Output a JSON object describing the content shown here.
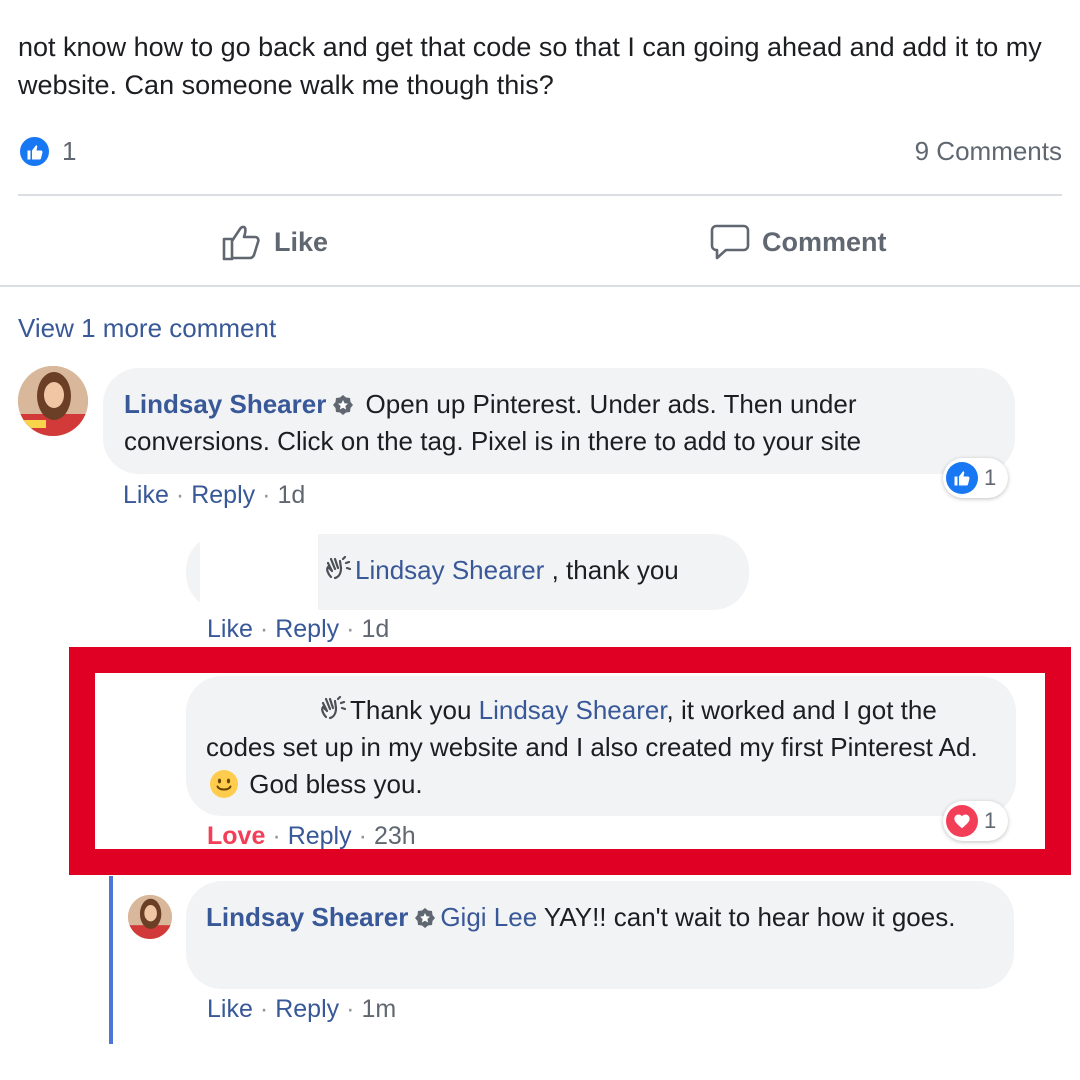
{
  "post": {
    "text": "not know how to go back and get that code so that I can going ahead and add it to my website. Can someone walk me though this?",
    "like_count": "1",
    "comments_count": "9 Comments"
  },
  "actions": {
    "like_label": "Like",
    "comment_label": "Comment"
  },
  "view_more": "View 1 more comment",
  "comments": [
    {
      "author": "Lindsay Shearer",
      "text": " Open up Pinterest. Under ads. Then under conversions. Click on the tag. Pixel is in there to add to your site",
      "meta": {
        "like": "Like",
        "reply": "Reply",
        "time": "1d"
      },
      "reaction_count": "1"
    },
    {
      "mention": "Lindsay Shearer",
      "text": " , thank you",
      "meta": {
        "like": "Like",
        "reply": "Reply",
        "time": "1d"
      }
    },
    {
      "text_before": "Thank you ",
      "mention": "Lindsay Shearer",
      "text_after": ", it worked and I got the codes set up in my website and I also created my first Pinterest Ad. ",
      "text_end": " God bless you.",
      "meta": {
        "love": "Love",
        "reply": "Reply",
        "time": "23h"
      },
      "reaction_count": "1"
    },
    {
      "author": "Lindsay Shearer",
      "mention": "Gigi Lee",
      "text": " YAY!! can't wait to hear how it goes.",
      "meta": {
        "like": "Like",
        "reply": "Reply",
        "time": "1m"
      }
    }
  ],
  "separator": "·",
  "colors": {
    "link_blue": "#385898",
    "facebook_blue": "#1877f2",
    "love_red": "#f33e58",
    "highlight_red": "#e00023",
    "bubble_gray": "#f2f3f5"
  }
}
